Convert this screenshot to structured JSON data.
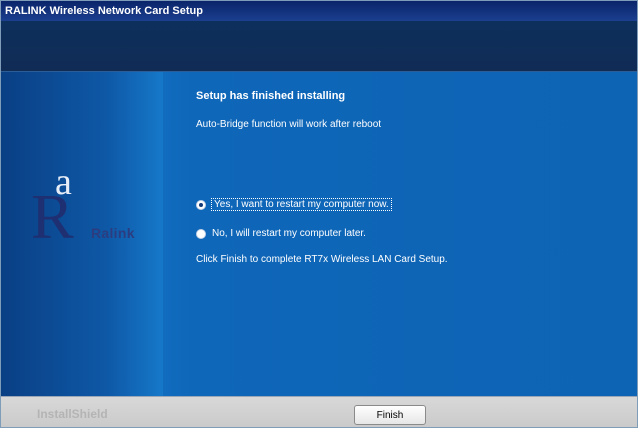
{
  "window": {
    "title": "RALINK Wireless Network Card Setup"
  },
  "brand": {
    "logo_letter_r": "R",
    "logo_letter_a": "a",
    "name": "Ralink"
  },
  "main": {
    "title": "Setup has finished installing",
    "subtitle": "Auto-Bridge function will work after reboot",
    "options": [
      {
        "label": "Yes, I want to restart my computer now.",
        "selected": true
      },
      {
        "label": "No, I will restart my computer later.",
        "selected": false
      }
    ],
    "instruction": "Click Finish to complete RT7x Wireless LAN Card Setup."
  },
  "footer": {
    "brand": "InstallShield",
    "finish_label": "Finish"
  },
  "colors": {
    "title_bar": "#0a246a",
    "main_bg": "#0d63b4",
    "left_panel": "#0a3f84"
  }
}
